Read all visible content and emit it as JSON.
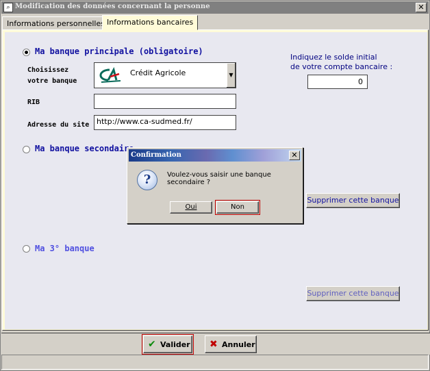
{
  "window": {
    "title": "Modification des données concernant la personne",
    "icon": "magnifier-app-icon",
    "close_label": "✕"
  },
  "tabs": [
    {
      "label": "Informations personnelles",
      "active": false
    },
    {
      "label": "Informations bancaires",
      "active": true
    }
  ],
  "bank1": {
    "title": "Ma banque principale (obligatoire)",
    "selected": true,
    "choose_label_1": "Choisissez",
    "choose_label_2": "votre banque",
    "bank_name": "Crédit Agricole",
    "bank_logo": "credit-agricole-logo",
    "rib_label": "RIB",
    "rib_value": "",
    "site_label": "Adresse du site",
    "site_value": "http://www.ca-sudmed.fr/",
    "balance_label_1": "Indiquez le solde initial",
    "balance_label_2": "de votre compte bancaire :",
    "balance_value": "0"
  },
  "bank2": {
    "title": "Ma banque secondaire",
    "selected": false,
    "delete_label": "Supprimer cette banque"
  },
  "bank3": {
    "title": "Ma 3° banque",
    "selected": false,
    "delete_label": "Supprimer cette banque"
  },
  "footer": {
    "validate_label": "Valider",
    "cancel_label": "Annuler"
  },
  "dialog": {
    "title": "Confirmation",
    "message": "Voulez-vous saisir une banque secondaire ?",
    "yes_label": "Oui",
    "no_label": "Non",
    "icon": "question-icon",
    "close_label": "✕"
  },
  "colors": {
    "panel_bg": "#fffbd8",
    "content_bg": "#e8e8f0",
    "heading_blue": "#1010a0",
    "focus_red": "#c00000",
    "validate_green": "#0a8a0a",
    "cancel_red": "#c00000"
  }
}
